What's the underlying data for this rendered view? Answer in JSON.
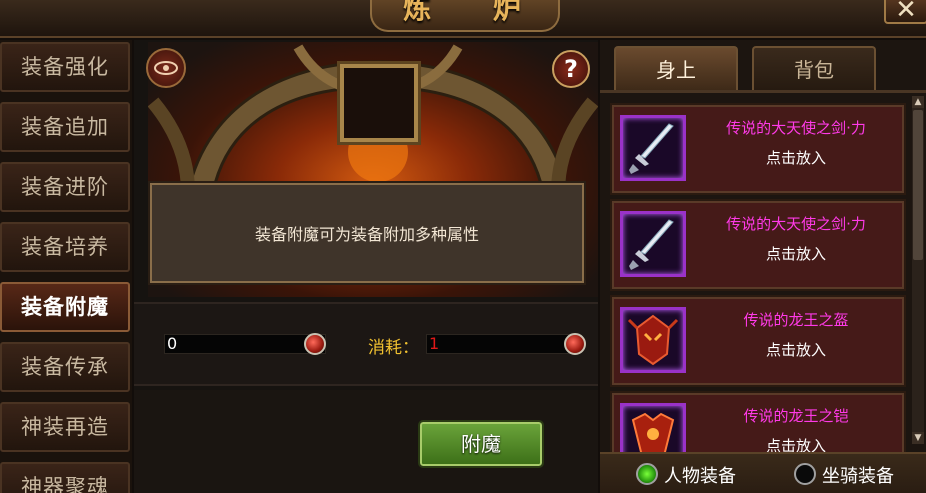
{
  "window": {
    "title": "炼 炉",
    "close_glyph": "✕"
  },
  "menu": {
    "items": [
      {
        "label": "装备强化",
        "active": false
      },
      {
        "label": "装备追加",
        "active": false
      },
      {
        "label": "装备进阶",
        "active": false
      },
      {
        "label": "装备培养",
        "active": false
      },
      {
        "label": "装备附魔",
        "active": true
      },
      {
        "label": "装备传承",
        "active": false
      },
      {
        "label": "神装再造",
        "active": false
      },
      {
        "label": "神器聚魂",
        "active": false
      }
    ]
  },
  "center": {
    "eye_icon": "eye-icon",
    "help_glyph": "?",
    "description": "装备附魔可为装备附加多种属性",
    "owned_amount": "0",
    "cost_label": "消耗：",
    "cost_value": "1",
    "enchant_button": "附魔"
  },
  "right": {
    "tabs": [
      {
        "label": "身上",
        "active": true
      },
      {
        "label": "背包",
        "active": false
      }
    ],
    "items": [
      {
        "name": "传说的大天使之剑·力",
        "action": "点击放入",
        "icon": "sword-icon"
      },
      {
        "name": "传说的大天使之剑·力",
        "action": "点击放入",
        "icon": "sword-icon"
      },
      {
        "name": "传说的龙王之盔",
        "action": "点击放入",
        "icon": "helmet-icon"
      },
      {
        "name": "传说的龙王之铠",
        "action": "点击放入",
        "icon": "armor-icon"
      }
    ],
    "filters": [
      {
        "label": "人物装备",
        "checked": true
      },
      {
        "label": "坐骑装备",
        "checked": false
      }
    ]
  },
  "colors": {
    "item_name": "#ff3ae8",
    "cost_label": "#f0c030",
    "cost_value": "#e01818",
    "button_green": "#5a9a2e"
  }
}
